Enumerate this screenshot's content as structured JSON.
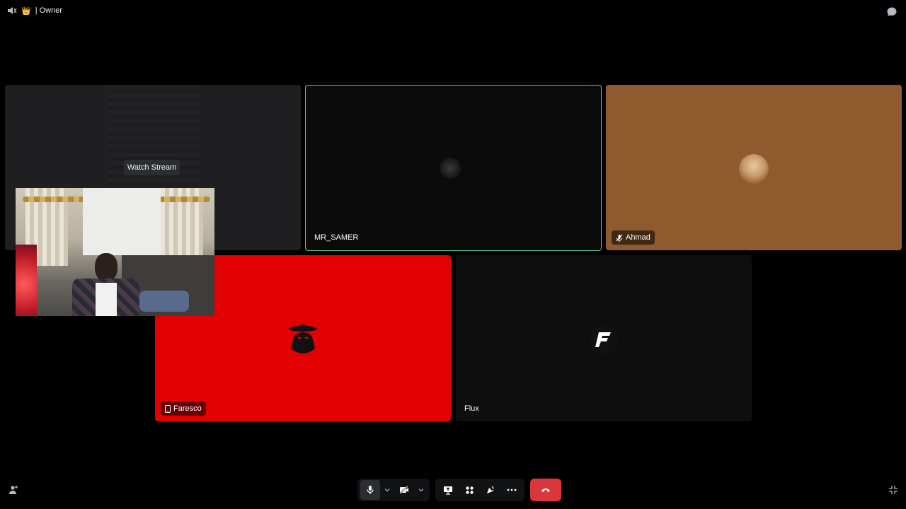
{
  "header": {
    "crown_emoji": "👑",
    "title": "| Owner"
  },
  "tiles": {
    "stream": {
      "watch_label": "Watch Stream"
    },
    "samer": {
      "name": "MR_SAMER",
      "speaking": true
    },
    "ahmad": {
      "name": "Ahmad",
      "muted": true,
      "bg_color": "#8f5a2e"
    },
    "faresco": {
      "name": "Faresco",
      "mobile": true,
      "bg_color": "#e20000"
    },
    "flux": {
      "name": "Flux"
    }
  },
  "controls": {
    "items": [
      "microphone-icon",
      "camera-off-icon",
      "screen-share-icon",
      "activities-icon",
      "soundboard-icon",
      "more-icon",
      "leave-call-icon"
    ],
    "accent_leave": "#da373c",
    "speaking_border": "#5bc589"
  }
}
